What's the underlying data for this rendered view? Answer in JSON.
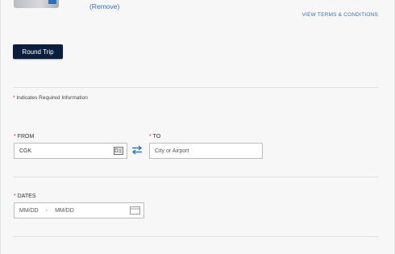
{
  "card": {
    "remove_label": "(Remove)",
    "terms_label": "VIEW TERMS & CONDITIONS"
  },
  "trip_type": {
    "label": "Round Trip"
  },
  "required_note": {
    "marker": "*",
    "text": " Indicates Required Information"
  },
  "from": {
    "marker": "*",
    "label": " FROM",
    "value": "CGK",
    "icon": "directory-card-icon"
  },
  "swap": {
    "icon": "swap-arrows-icon"
  },
  "to": {
    "marker": "*",
    "label": " TO",
    "placeholder": "City or Airport"
  },
  "dates": {
    "marker": "*",
    "label": " DATES",
    "start_placeholder": "MM/DD",
    "separator": "-",
    "end_placeholder": "MM/DD",
    "icon": "calendar-icon"
  },
  "colors": {
    "primary_button": "#0b1e3f",
    "link": "#3a6fb0",
    "required": "#c0392b"
  }
}
